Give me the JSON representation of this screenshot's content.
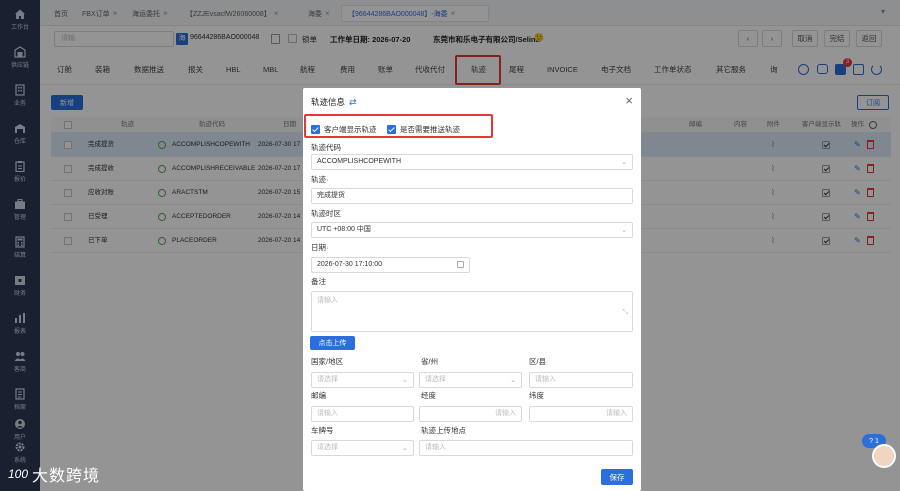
{
  "sidebar": {
    "items": [
      {
        "label": "工作台",
        "icon": "home-icon"
      },
      {
        "label": "供应链",
        "icon": "warehouse-icon"
      },
      {
        "label": "业务",
        "icon": "building-icon"
      },
      {
        "label": "仓库",
        "icon": "storage-icon"
      },
      {
        "label": "报价",
        "icon": "clipboard-icon"
      },
      {
        "label": "管理",
        "icon": "briefcase-icon"
      },
      {
        "label": "结算",
        "icon": "calculator-icon"
      },
      {
        "label": "财务",
        "icon": "finance-icon"
      },
      {
        "label": "报表",
        "icon": "chart-icon"
      },
      {
        "label": "客商",
        "icon": "users-icon"
      },
      {
        "label": "档案",
        "icon": "archive-icon"
      },
      {
        "label": "用户",
        "icon": "user-icon"
      },
      {
        "label": "系统",
        "icon": "gear-icon"
      }
    ]
  },
  "tabs": [
    {
      "label": "首页",
      "closable": false
    },
    {
      "label": "FBX订单",
      "closable": true
    },
    {
      "label": "海运委托",
      "closable": true
    },
    {
      "label": "【ZZJEvsacfW26060008】",
      "closable": true
    },
    {
      "label": "海委",
      "closable": true
    },
    {
      "label": "【96644286BAO000048】-海委",
      "closable": true,
      "active": true
    }
  ],
  "toolbar": {
    "search_placeholder": "请输",
    "badge": "海",
    "order_no": "96644286BAO000048",
    "lock_label": "锁单",
    "date_label": "工作单日期: 2026-07-20",
    "company": "东莞市和乐电子有限公司/Selina",
    "cancel": "取消",
    "complete": "完结",
    "back": "返回"
  },
  "menu": [
    "订舱",
    "装箱",
    "数据推送",
    "报关",
    "HBL",
    "MBL",
    "航程",
    "费用",
    "账单",
    "代收代付",
    "轨迹",
    "尾程",
    "INVOICE",
    "电子文档",
    "工作单状态",
    "其它服务",
    "询"
  ],
  "menu_badge": "3",
  "grid": {
    "new_button": "新增",
    "order_button": "订阅",
    "headers": [
      "轨迹",
      "轨迹代码",
      "日期",
      "邮编",
      "内容",
      "附件",
      "客户端显示轨",
      "操作"
    ],
    "rows": [
      {
        "name": "完成提货",
        "code": "ACCOMPLISHCOPEWITH",
        "date": "2026-07-30 17"
      },
      {
        "name": "完成提收",
        "code": "ACCOMPLISHRECEIVABLE",
        "date": "2026-07-20 17"
      },
      {
        "name": "应收对账",
        "code": "ARACTSTM",
        "date": "2026-07-20 15"
      },
      {
        "name": "已受理",
        "code": "ACCEPTEDORDER",
        "date": "2026-07-20 14"
      },
      {
        "name": "已下单",
        "code": "PLACEORDER",
        "date": "2026-07-20 14"
      }
    ]
  },
  "modal": {
    "title": "轨迹信息",
    "check_client": "客户端显示轨迹",
    "check_push": "是否需要推送轨迹",
    "code_label": "轨迹代码",
    "code_value": "ACCOMPLISHCOPEWITH",
    "track_label": "轨迹·",
    "track_value": "完成提货",
    "tz_label": "轨迹时区",
    "tz_value": "UTC +08:00 中国",
    "date_label": "日期·",
    "date_value": "2026-07-30 17:10:00",
    "remark_label": "备注",
    "remark_placeholder": "请输入",
    "upload_button": "点击上传",
    "country_label": "国家/地区",
    "country_placeholder": "请选择",
    "province_label": "省/州",
    "province_placeholder": "请选择",
    "district_label": "区/县",
    "district_placeholder": "请输入",
    "zip_label": "邮编",
    "zip_placeholder": "请输入",
    "lng_label": "经度",
    "lng_placeholder": "请输入",
    "lat_label": "纬度",
    "lat_placeholder": "请输入",
    "plate_label": "车牌号",
    "plate_placeholder": "请选择",
    "place_label": "轨迹上传地点",
    "place_placeholder": "请输入",
    "save_button": "保存"
  },
  "help_badge": "1",
  "watermark": {
    "logo": "100",
    "text": "大数跨境"
  },
  "colors": {
    "accent": "#2a6fdb",
    "sidebar": "#2b3a55",
    "highlight": "#e53935"
  }
}
